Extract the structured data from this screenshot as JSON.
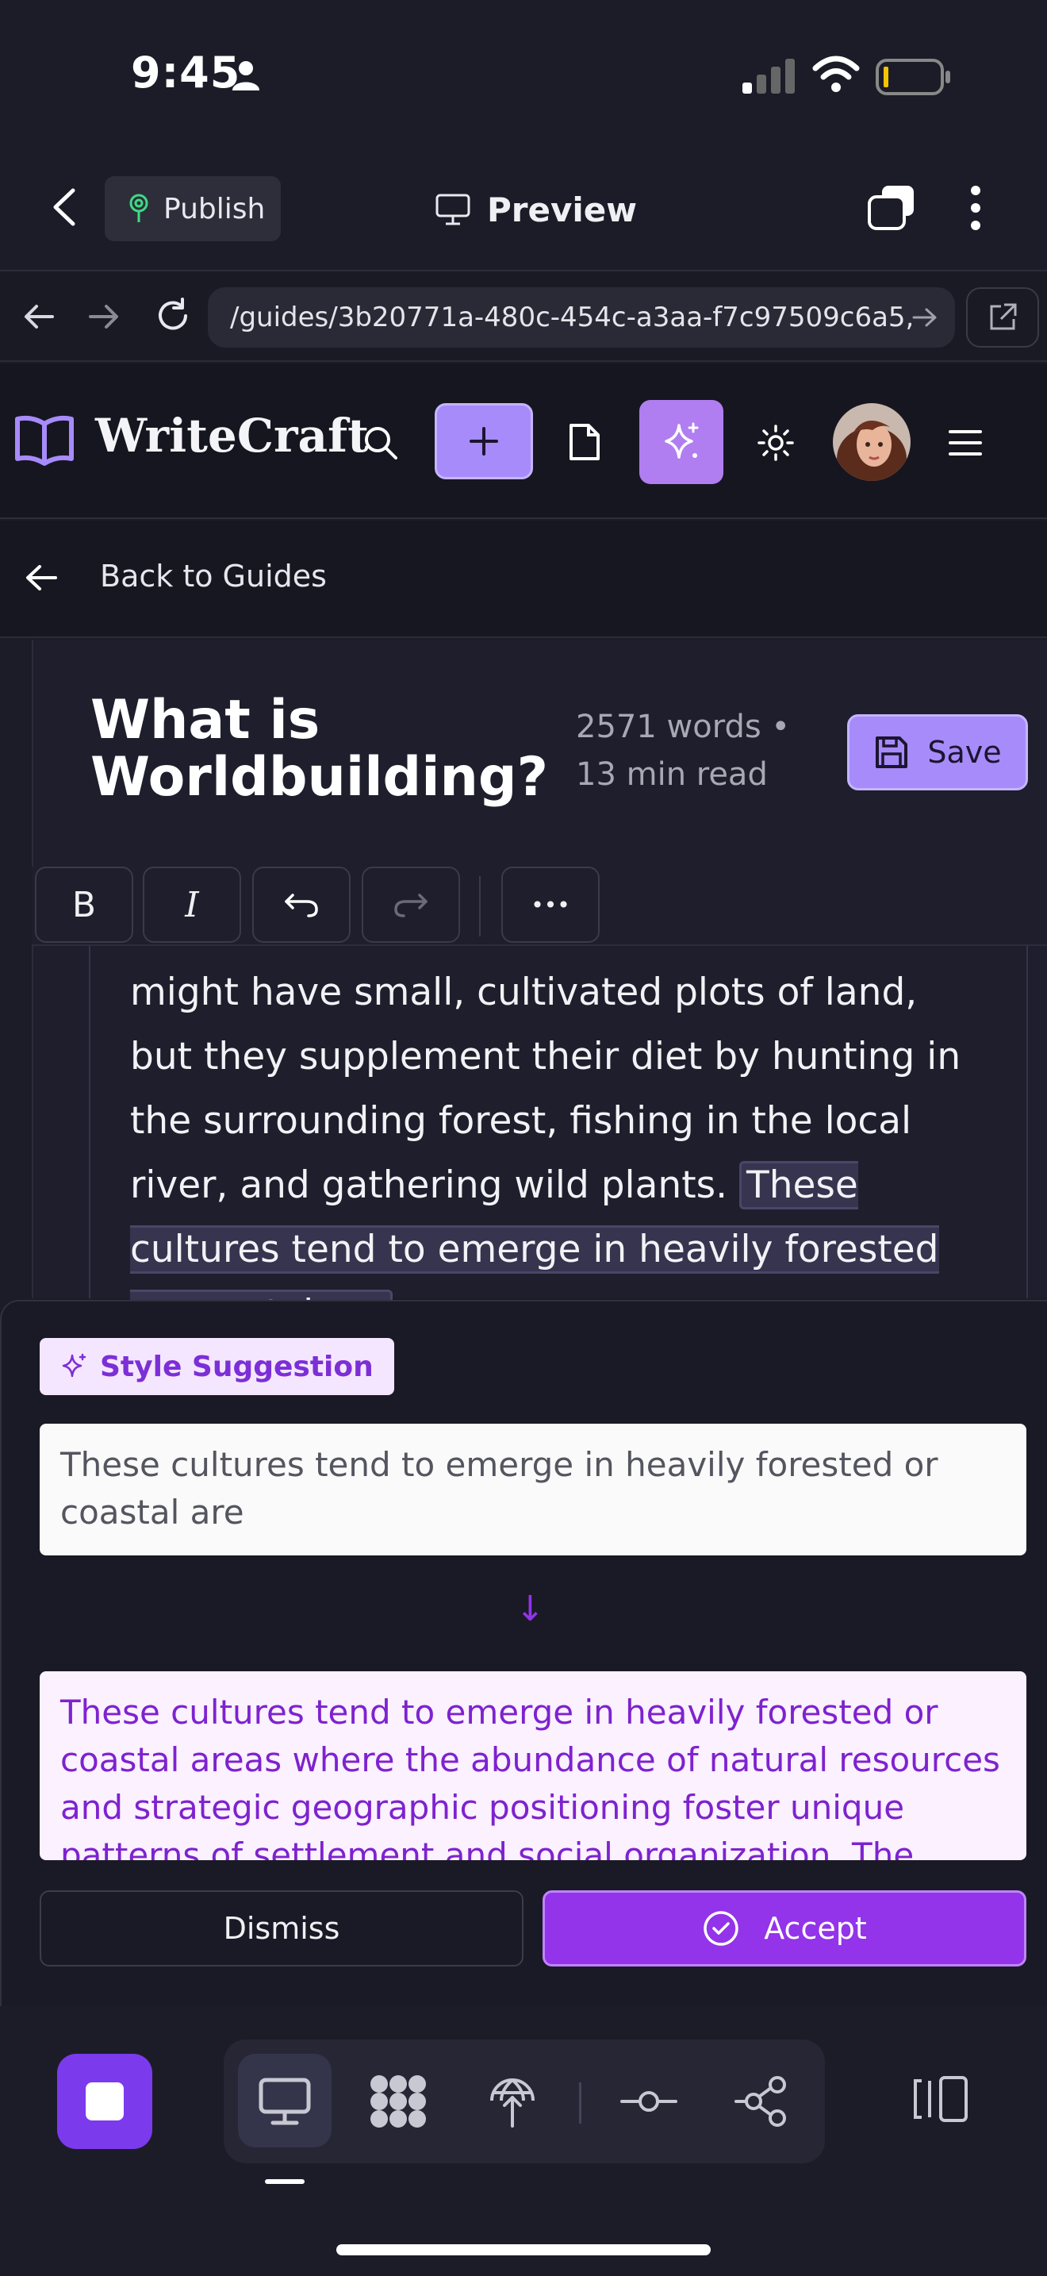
{
  "status_bar": {
    "time": "9:45"
  },
  "toolbar": {
    "publish_label": "Publish",
    "preview_label": "Preview"
  },
  "browser": {
    "url": "/guides/3b20771a-480c-454c-a3aa-f7c97509c6a5,"
  },
  "app": {
    "brand": "WriteCraft",
    "back_label": "Back to Guides"
  },
  "document": {
    "title": "What is Worldbuilding?",
    "meta_words": "2571 words •",
    "meta_read": "13 min read",
    "save_label": "Save",
    "body_text": "might have small, cultivated plots of land, but they supplement their diet by hunting in the surrounding forest, fishing in the local river, and gathering wild plants.",
    "highlighted_text": "These cultures tend to emerge in heavily forested or coastal are"
  },
  "format_toolbar": {
    "bold": "B",
    "italic": "I",
    "more": "•••"
  },
  "suggestion": {
    "badge_label": "Style Suggestion",
    "original": "These cultures tend to emerge in heavily forested or coastal are",
    "arrow": "↓",
    "suggested": "These cultures tend to emerge in heavily forested or coastal areas where the abundance of natural resources and strategic geographic positioning foster unique patterns of settlement and social organization. The dense canopy of",
    "dismiss_label": "Dismiss",
    "accept_label": "Accept"
  },
  "colors": {
    "accent": "#a78bfa",
    "accept": "#9333ea",
    "badge_bg": "#f5e6ff",
    "suggestion_text": "#7e22ce"
  }
}
